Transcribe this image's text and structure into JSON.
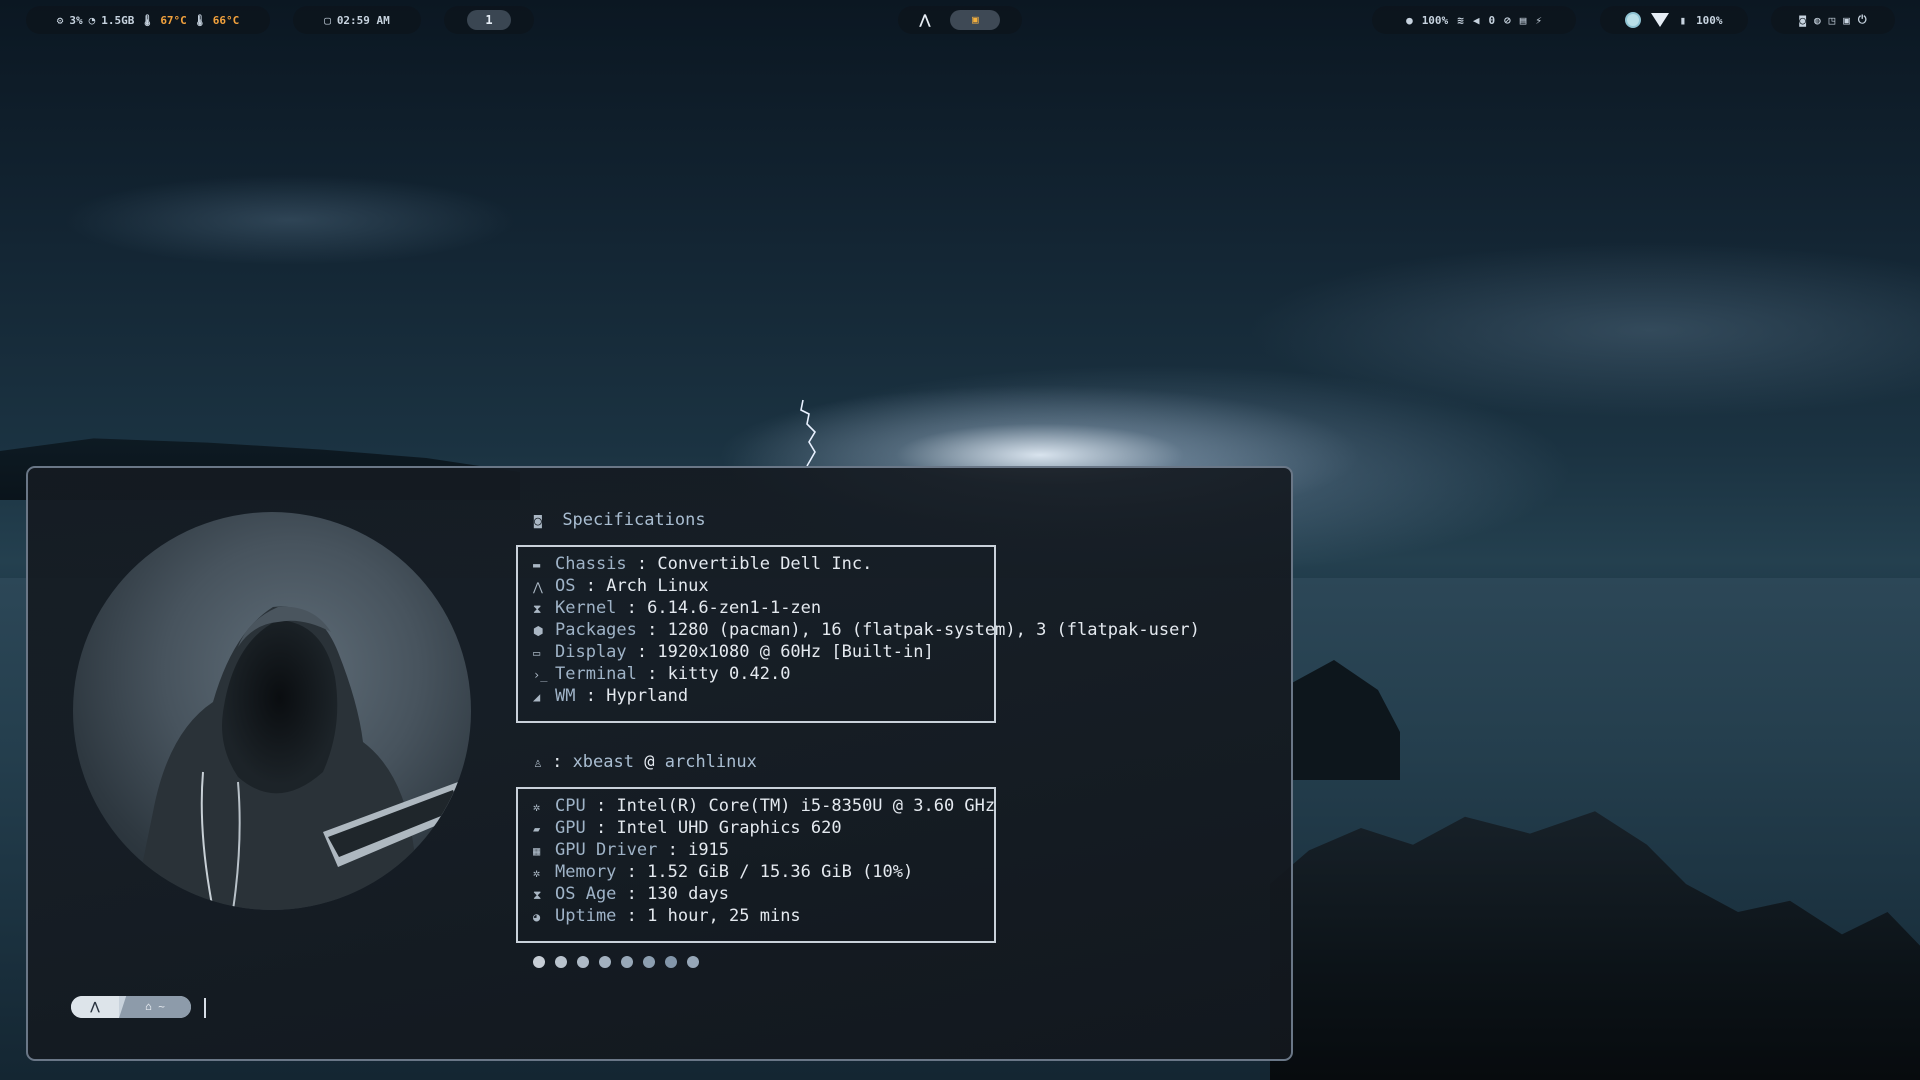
{
  "colors": {
    "accent_orange": "#f3a23d",
    "text_primary": "#e4e9ef",
    "text_label": "#9fb3c7",
    "window_border": "#6a7787"
  },
  "topbar": {
    "system": {
      "cpu": "3%",
      "ram": "1.5GB",
      "temp1": "67°C",
      "temp2": "66°C"
    },
    "clock": {
      "time": "02:59 AM"
    },
    "workspace": {
      "active": "1"
    },
    "status": {
      "brightness": "100%",
      "volume": "0",
      "icons": [
        "brightness-icon",
        "wifi-icon",
        "volume-icon",
        "mic-muted-icon",
        "keyboard-icon",
        "charging-icon"
      ]
    },
    "network": {
      "battery": "100%"
    },
    "power_icons": [
      "notification-icon",
      "palette-icon",
      "screenshot-icon",
      "clipboard-icon",
      "power-icon"
    ]
  },
  "fetch": {
    "spec_title": "Specifications",
    "specs": [
      {
        "icon": "chassis-icon",
        "glyph": "▬",
        "key": "Chassis",
        "value": "Convertible Dell Inc."
      },
      {
        "icon": "arch-icon",
        "glyph": "⋀",
        "key": "OS",
        "value": "Arch Linux"
      },
      {
        "icon": "kernel-icon",
        "glyph": "⧗",
        "key": "Kernel",
        "value": "6.14.6-zen1-1-zen"
      },
      {
        "icon": "package-icon",
        "glyph": "⬢",
        "key": "Packages",
        "value": "1280 (pacman), 16 (flatpak-system), 3 (flatpak-user)"
      },
      {
        "icon": "display-icon",
        "glyph": "▭",
        "key": "Display",
        "value": "1920x1080 @ 60Hz [Built-in]"
      },
      {
        "icon": "terminal-icon",
        "glyph": "›_",
        "key": "Terminal",
        "value": "kitty 0.42.0"
      },
      {
        "icon": "wm-icon",
        "glyph": "◢",
        "key": "WM",
        "value": "Hyprland"
      }
    ],
    "user": {
      "user": "xbeast",
      "at": "@",
      "host": "archlinux"
    },
    "hardware": [
      {
        "icon": "cpu-icon",
        "glyph": "✲",
        "key": "CPU",
        "sep": " : ",
        "value": "Intel(R) Core(TM) i5-8350U @ 3.60 GHz"
      },
      {
        "icon": "gpu-icon",
        "glyph": "▰",
        "key": "GPU",
        "sep": " : ",
        "value": "Intel UHD Graphics 620"
      },
      {
        "icon": "driver-icon",
        "glyph": "▦",
        "key": "GPU Driver",
        "sep": " : ",
        "value": "i915"
      },
      {
        "icon": "memory-icon",
        "glyph": "✲",
        "key": "Memory",
        "sep": "  : ",
        "value": "1.52 GiB / 15.36 GiB (10%)"
      },
      {
        "icon": "hourglass-icon",
        "glyph": "⧗",
        "key": "OS Age",
        "sep": "  : ",
        "value": "130 days"
      },
      {
        "icon": "uptime-icon",
        "glyph": "◕",
        "key": "Uptime",
        "sep": "  : ",
        "value": "1 hour, 25 mins"
      }
    ],
    "palette": [
      "#c7ced6",
      "#b9c3cd",
      "#aebac6",
      "#a3b1bf",
      "#98a8b8",
      "#8d9fb1",
      "#8396aa",
      "#97a7b8"
    ]
  },
  "prompt": {
    "segments": [
      "⋀",
      "⌂ ~"
    ]
  }
}
